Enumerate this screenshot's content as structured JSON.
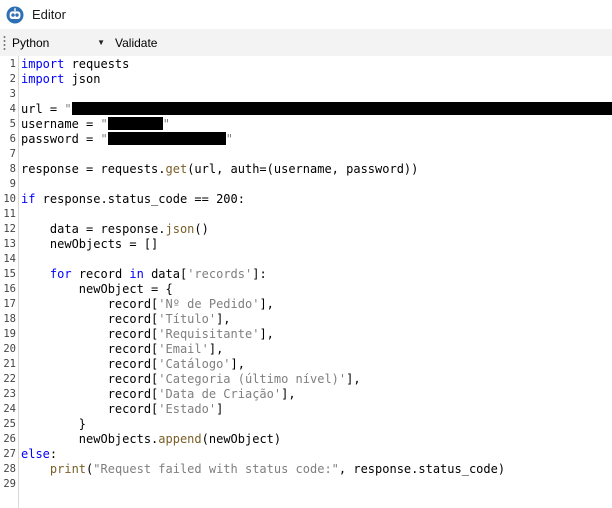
{
  "window": {
    "title": "Editor",
    "icon": "robot-icon"
  },
  "toolbar": {
    "language": "Python",
    "validate_label": "Validate"
  },
  "colors": {
    "keyword": "#0000ff",
    "function": "#795e26",
    "string": "#7f7f7f",
    "text": "#000000"
  },
  "editor": {
    "lines": [
      {
        "n": "1",
        "segs": [
          [
            "kw",
            "import"
          ],
          [
            "p",
            " requests"
          ]
        ]
      },
      {
        "n": "2",
        "segs": [
          [
            "kw",
            "import"
          ],
          [
            "p",
            " json"
          ]
        ]
      },
      {
        "n": "3",
        "segs": []
      },
      {
        "n": "4",
        "segs": [
          [
            "p",
            "url = "
          ],
          [
            "str",
            "\""
          ],
          [
            "redacted",
            "540"
          ]
        ]
      },
      {
        "n": "5",
        "segs": [
          [
            "p",
            "username = "
          ],
          [
            "str",
            "\""
          ],
          [
            "redacted",
            "55"
          ],
          [
            "str",
            "\""
          ]
        ]
      },
      {
        "n": "6",
        "segs": [
          [
            "p",
            "password = "
          ],
          [
            "str",
            "\""
          ],
          [
            "redacted",
            "118"
          ],
          [
            "str",
            "\""
          ]
        ]
      },
      {
        "n": "7",
        "segs": []
      },
      {
        "n": "8",
        "segs": [
          [
            "p",
            "response = requests."
          ],
          [
            "fn",
            "get"
          ],
          [
            "p",
            "(url, auth=(username, password))"
          ]
        ]
      },
      {
        "n": "9",
        "segs": []
      },
      {
        "n": "10",
        "segs": [
          [
            "kw",
            "if"
          ],
          [
            "p",
            " response.status_code == 200:"
          ]
        ]
      },
      {
        "n": "11",
        "segs": []
      },
      {
        "n": "12",
        "segs": [
          [
            "p",
            "    data = response."
          ],
          [
            "fn",
            "json"
          ],
          [
            "p",
            "()"
          ]
        ]
      },
      {
        "n": "13",
        "segs": [
          [
            "p",
            "    newObjects = []"
          ]
        ]
      },
      {
        "n": "14",
        "segs": []
      },
      {
        "n": "15",
        "segs": [
          [
            "p",
            "    "
          ],
          [
            "kw",
            "for"
          ],
          [
            "p",
            " record "
          ],
          [
            "kw",
            "in"
          ],
          [
            "p",
            " data["
          ],
          [
            "str",
            "'records'"
          ],
          [
            "p",
            "]:"
          ]
        ]
      },
      {
        "n": "16",
        "segs": [
          [
            "p",
            "        newObject = {"
          ]
        ]
      },
      {
        "n": "17",
        "segs": [
          [
            "p",
            "            record["
          ],
          [
            "str",
            "'Nº de Pedido'"
          ],
          [
            "p",
            "],"
          ]
        ]
      },
      {
        "n": "18",
        "segs": [
          [
            "p",
            "            record["
          ],
          [
            "str",
            "'Título'"
          ],
          [
            "p",
            "],"
          ]
        ]
      },
      {
        "n": "19",
        "segs": [
          [
            "p",
            "            record["
          ],
          [
            "str",
            "'Requisitante'"
          ],
          [
            "p",
            "],"
          ]
        ]
      },
      {
        "n": "20",
        "segs": [
          [
            "p",
            "            record["
          ],
          [
            "str",
            "'Email'"
          ],
          [
            "p",
            "],"
          ]
        ]
      },
      {
        "n": "21",
        "segs": [
          [
            "p",
            "            record["
          ],
          [
            "str",
            "'Catálogo'"
          ],
          [
            "p",
            "],"
          ]
        ]
      },
      {
        "n": "22",
        "segs": [
          [
            "p",
            "            record["
          ],
          [
            "str",
            "'Categoria (último nível)'"
          ],
          [
            "p",
            "],"
          ]
        ]
      },
      {
        "n": "23",
        "segs": [
          [
            "p",
            "            record["
          ],
          [
            "str",
            "'Data de Criação'"
          ],
          [
            "p",
            "],"
          ]
        ]
      },
      {
        "n": "24",
        "segs": [
          [
            "p",
            "            record["
          ],
          [
            "str",
            "'Estado'"
          ],
          [
            "p",
            "]"
          ]
        ]
      },
      {
        "n": "25",
        "segs": [
          [
            "p",
            "        }"
          ]
        ]
      },
      {
        "n": "26",
        "segs": [
          [
            "p",
            "        newObjects."
          ],
          [
            "fn",
            "append"
          ],
          [
            "p",
            "(newObject)"
          ]
        ]
      },
      {
        "n": "27",
        "segs": [
          [
            "kw",
            "else"
          ],
          [
            "p",
            ":"
          ]
        ]
      },
      {
        "n": "28",
        "segs": [
          [
            "p",
            "    "
          ],
          [
            "fn",
            "print"
          ],
          [
            "p",
            "("
          ],
          [
            "str",
            "\"Request failed with status code:\""
          ],
          [
            "p",
            ", response.status_code)"
          ]
        ]
      },
      {
        "n": "29",
        "segs": []
      }
    ]
  }
}
